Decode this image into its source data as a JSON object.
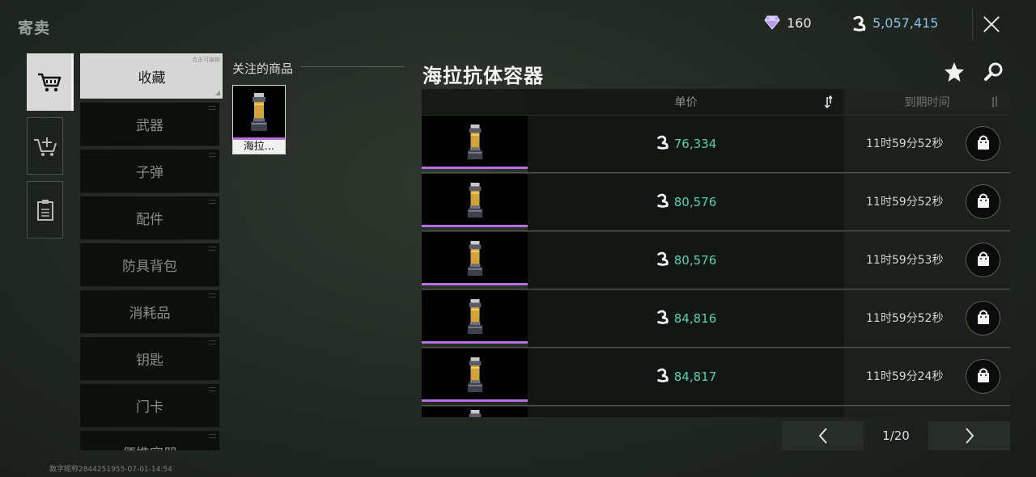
{
  "header": {
    "title": "寄卖",
    "gem_icon": "diamond-icon",
    "gem_balance": "160",
    "coin_icon": "coin-icon",
    "coin_balance": "5,057,415",
    "close_icon": "close-icon"
  },
  "rail": [
    {
      "icon": "cart-icon",
      "active": true
    },
    {
      "icon": "cart-add-icon",
      "active": false
    },
    {
      "icon": "clipboard-icon",
      "active": false
    }
  ],
  "categories": [
    {
      "label": "收藏",
      "active": true,
      "tag": "点击可编辑"
    },
    {
      "label": "武器"
    },
    {
      "label": "子弹"
    },
    {
      "label": "配件"
    },
    {
      "label": "防具背包"
    },
    {
      "label": "消耗品"
    },
    {
      "label": "钥匙"
    },
    {
      "label": "门卡"
    },
    {
      "label": "便携容器"
    }
  ],
  "watchlist": {
    "title": "关注的商品",
    "items": [
      {
        "name": "海拉...",
        "rarity_color": "#b66fe0"
      }
    ]
  },
  "listing": {
    "title": "海拉抗体容器",
    "star_icon": "star-icon",
    "search_icon": "search-icon",
    "columns": {
      "price": "单价",
      "expiry": "到期时间"
    },
    "rows": [
      {
        "price": "76,334",
        "time": "11时59分52秒"
      },
      {
        "price": "80,576",
        "time": "11时59分52秒"
      },
      {
        "price": "80,576",
        "time": "11时59分53秒"
      },
      {
        "price": "84,816",
        "time": "11时59分52秒"
      },
      {
        "price": "84,817",
        "time": "11时59分24秒"
      }
    ]
  },
  "pagination": {
    "page": "1/20",
    "prev_icon": "chevron-left-icon",
    "next_icon": "chevron-right-icon"
  },
  "watermark": "数字昵称2844251955-07-01-14:54",
  "colors": {
    "accent_price": "#4fd1b2",
    "rarity": "#b66fe0",
    "coin_text": "#8cc0e6"
  }
}
